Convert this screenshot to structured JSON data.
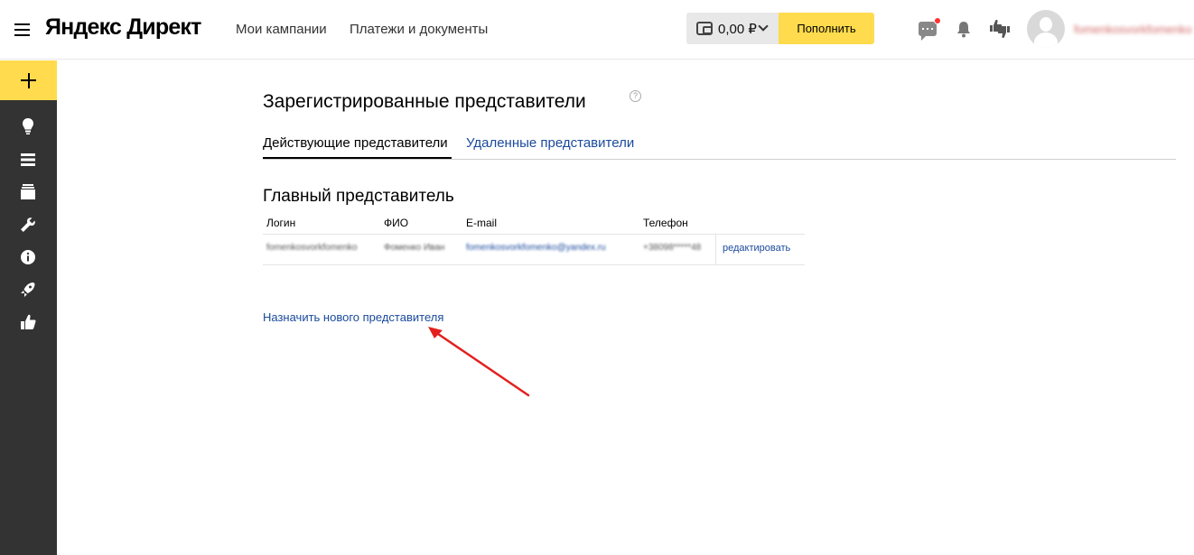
{
  "header": {
    "logo": "Яндекс Директ",
    "nav": [
      "Мои кампании",
      "Платежи и документы"
    ],
    "balance": "0,00 ₽",
    "topup_label": "Пополнить",
    "username": "fomenkosvorkfomenko"
  },
  "sidebar": {
    "icons": [
      "add-icon",
      "lightbulb-icon",
      "list-icon",
      "archive-icon",
      "wrench-icon",
      "info-icon",
      "rocket-icon",
      "thumbs-up-icon"
    ]
  },
  "main": {
    "title": "Зарегистрированные представители",
    "help": "?",
    "tabs": [
      {
        "label": "Действующие представители",
        "active": true
      },
      {
        "label": "Удаленные представители",
        "active": false
      }
    ],
    "section_title": "Главный представитель",
    "table": {
      "headers": [
        "Логин",
        "ФИО",
        "E-mail",
        "Телефон"
      ],
      "rows": [
        {
          "login": "fomenkosvorkfomenko",
          "fio": "Фоменко Иван",
          "email": "fomenkosvorkfomenko@yandex.ru",
          "phone": "+38098*****48",
          "edit": "редактировать"
        }
      ]
    },
    "assign_link": "Назначить нового представителя"
  },
  "colors": {
    "accent_yellow": "#ffdb4d",
    "link_blue": "#1a4a9c",
    "sidebar_bg": "#333333",
    "annotation_arrow": "#e3201e"
  }
}
